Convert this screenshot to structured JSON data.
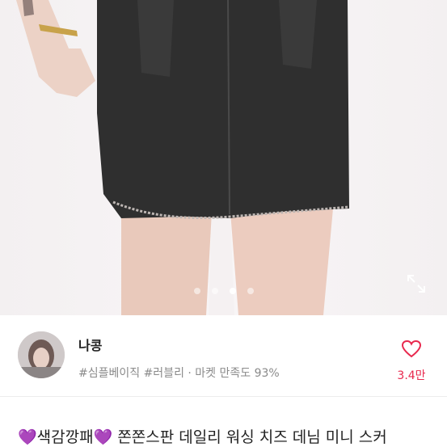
{
  "product": {
    "images": {
      "count": 5,
      "active_index": 3
    },
    "title": {
      "emoji_left": "💜",
      "tag": "색감깡패",
      "emoji_right": "💜",
      "text": "쫀쫀스판 데일리 워싱 치즈 데님 미니 스커"
    }
  },
  "seller": {
    "name": "나콩",
    "meta": "#심플베이직 #러블리 · 마켓 만족도 93%",
    "likes": "3.4만"
  },
  "colors": {
    "like_red": "#e8284d",
    "emoji_purple": "#9b3ee0",
    "denim": "#2f2f2f"
  },
  "icons": {
    "expand": "expand-icon",
    "heart": "heart-outline-icon"
  }
}
